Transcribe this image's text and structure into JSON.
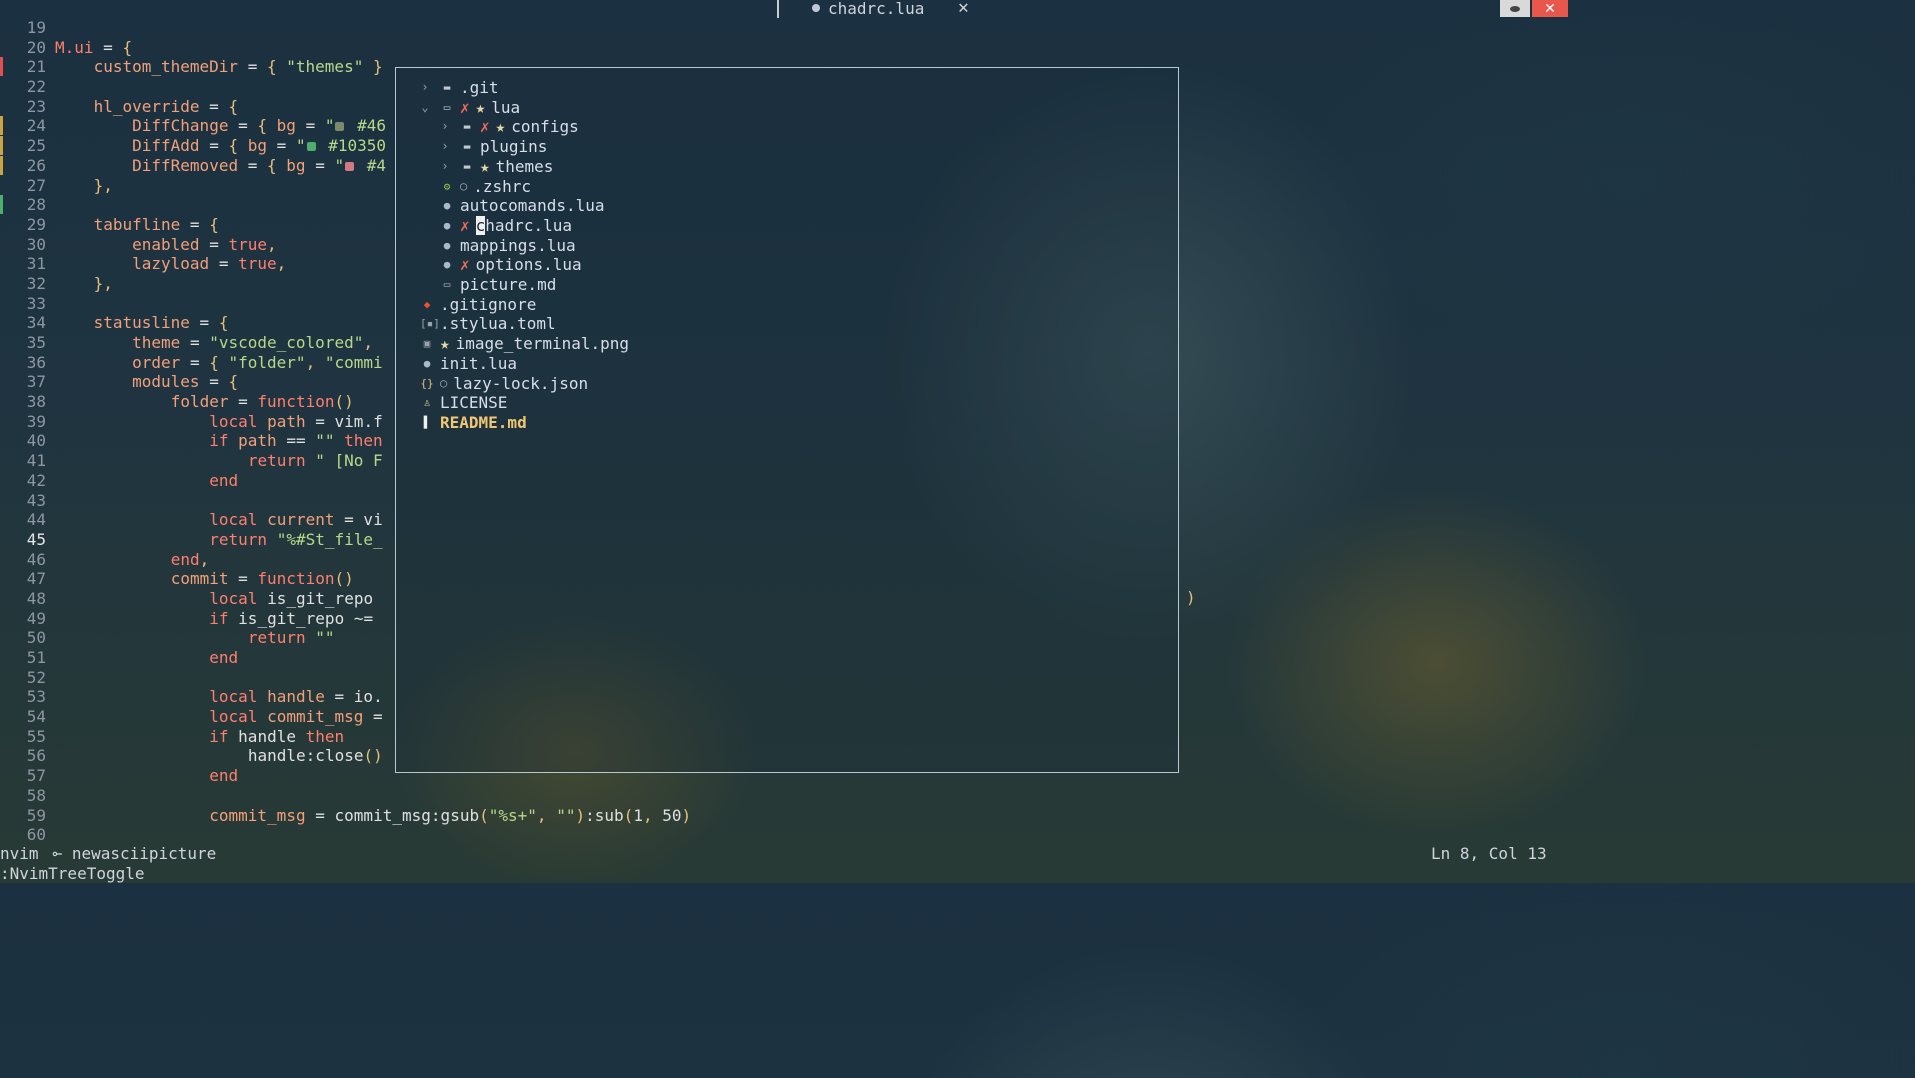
{
  "tab": {
    "title": "chadrc.lua",
    "close_glyph": "✕"
  },
  "window_controls": {
    "close_glyph": "✕"
  },
  "code_lines": [
    {
      "n": "19",
      "t": ""
    },
    {
      "n": "20",
      "t": "M.ui = {"
    },
    {
      "n": "21",
      "t": "    custom_themeDir = { \"themes\" }"
    },
    {
      "n": "22",
      "t": ""
    },
    {
      "n": "23",
      "t": "    hl_override = {"
    },
    {
      "n": "24",
      "t": "        DiffChange = { bg = \"■ #46"
    },
    {
      "n": "25",
      "t": "        DiffAdd = { bg = \"■ #10350"
    },
    {
      "n": "26",
      "t": "        DiffRemoved = { bg = \"■ #4"
    },
    {
      "n": "27",
      "t": "    },"
    },
    {
      "n": "28",
      "t": ""
    },
    {
      "n": "29",
      "t": "    tabufline = {"
    },
    {
      "n": "30",
      "t": "        enabled = true,"
    },
    {
      "n": "31",
      "t": "        lazyload = true,"
    },
    {
      "n": "32",
      "t": "    },"
    },
    {
      "n": "33",
      "t": ""
    },
    {
      "n": "34",
      "t": "    statusline = {"
    },
    {
      "n": "35",
      "t": "        theme = \"vscode_colored\","
    },
    {
      "n": "36",
      "t": "        order = { \"folder\", \"commi"
    },
    {
      "n": "37",
      "t": "        modules = {"
    },
    {
      "n": "38",
      "t": "            folder = function()"
    },
    {
      "n": "39",
      "t": "                local path = vim.f"
    },
    {
      "n": "40",
      "t": "                if path == \"\" then"
    },
    {
      "n": "41",
      "t": "                    return \" [No F"
    },
    {
      "n": "42",
      "t": "                end"
    },
    {
      "n": "43",
      "t": ""
    },
    {
      "n": "44",
      "t": "                local current = vi"
    },
    {
      "n": "45",
      "t": "                return \"%#St_file_"
    },
    {
      "n": "46",
      "t": "            end,"
    },
    {
      "n": "47",
      "t": "            commit = function()"
    },
    {
      "n": "48",
      "t": "                local is_git_repo"
    },
    {
      "n": "49",
      "t": "                if is_git_repo ~="
    },
    {
      "n": "50",
      "t": "                    return \"\""
    },
    {
      "n": "51",
      "t": "                end"
    },
    {
      "n": "52",
      "t": ""
    },
    {
      "n": "53",
      "t": "                local handle = io."
    },
    {
      "n": "54",
      "t": "                local commit_msg ="
    },
    {
      "n": "55",
      "t": "                if handle then"
    },
    {
      "n": "56",
      "t": "                    handle:close()"
    },
    {
      "n": "57",
      "t": "                end"
    },
    {
      "n": "58",
      "t": ""
    },
    {
      "n": "59",
      "t": "                commit_msg = commit_msg:gsub(\"%s+\", \"\"):sub(1, 50)"
    },
    {
      "n": "60",
      "t": ""
    }
  ],
  "colors": {
    "diff_change": "#46",
    "diff_add": "#10350",
    "diff_removed": "#4",
    "swatch_change": "#7a8a6a",
    "swatch_add": "#4fae6a",
    "swatch_removed": "#d27a82"
  },
  "tree": [
    {
      "label": ".git",
      "depth": 0,
      "chev": "›",
      "icon": "folder-icon",
      "git": "",
      "star": false,
      "ring": false
    },
    {
      "label": "lua",
      "depth": 0,
      "chev": "⌄",
      "icon": "folder-open-icon",
      "git": "✗",
      "star": true,
      "ring": false
    },
    {
      "label": "configs",
      "depth": 1,
      "chev": "›",
      "icon": "folder-icon",
      "git": "✗",
      "star": true,
      "ring": false
    },
    {
      "label": "plugins",
      "depth": 1,
      "chev": "›",
      "icon": "folder-icon",
      "git": "",
      "star": false,
      "ring": false
    },
    {
      "label": "themes",
      "depth": 1,
      "chev": "›",
      "icon": "folder-icon",
      "git": "",
      "star": true,
      "ring": false
    },
    {
      "label": ".zshrc",
      "depth": 1,
      "chev": "",
      "icon": "gear-icon",
      "git": "",
      "star": false,
      "ring": true
    },
    {
      "label": "autocomands.lua",
      "depth": 1,
      "chev": "",
      "icon": "lua-icon",
      "git": "",
      "star": false,
      "ring": false
    },
    {
      "label": "chadrc.lua",
      "depth": 1,
      "chev": "",
      "icon": "lua-icon",
      "git": "✗",
      "star": false,
      "ring": false
    },
    {
      "label": "mappings.lua",
      "depth": 1,
      "chev": "",
      "icon": "lua-icon",
      "git": "",
      "star": false,
      "ring": false
    },
    {
      "label": "options.lua",
      "depth": 1,
      "chev": "",
      "icon": "lua-icon",
      "git": "✗",
      "star": false,
      "ring": false
    },
    {
      "label": "picture.md",
      "depth": 1,
      "chev": "",
      "icon": "markdown-icon",
      "git": "",
      "star": false,
      "ring": false
    },
    {
      "label": ".gitignore",
      "depth": 0,
      "chev": "",
      "icon": "git-icon",
      "git": "",
      "star": false,
      "ring": false
    },
    {
      "label": ".stylua.toml",
      "depth": 0,
      "chev": "",
      "icon": "toml-icon",
      "git": "",
      "star": false,
      "ring": false
    },
    {
      "label": "image_terminal.png",
      "depth": 0,
      "chev": "",
      "icon": "image-icon",
      "git": "",
      "star": true,
      "ring": false
    },
    {
      "label": "init.lua",
      "depth": 0,
      "chev": "",
      "icon": "lua-icon",
      "git": "",
      "star": false,
      "ring": false
    },
    {
      "label": "lazy-lock.json",
      "depth": 0,
      "chev": "",
      "icon": "json-icon",
      "git": "",
      "star": false,
      "ring": true
    },
    {
      "label": "LICENSE",
      "depth": 0,
      "chev": "",
      "icon": "license-icon",
      "git": "",
      "star": false,
      "ring": false
    },
    {
      "label": "README.md",
      "depth": 0,
      "chev": "",
      "icon": "readme-icon",
      "git": "",
      "star": false,
      "ring": false
    }
  ],
  "status": {
    "mode": "nvim",
    "branch_glyph": "⟜",
    "branch": "newasciipicture",
    "position": "Ln 8, Col 13"
  },
  "cmdline": ":NvimTreeToggle",
  "stray_paren": ")"
}
